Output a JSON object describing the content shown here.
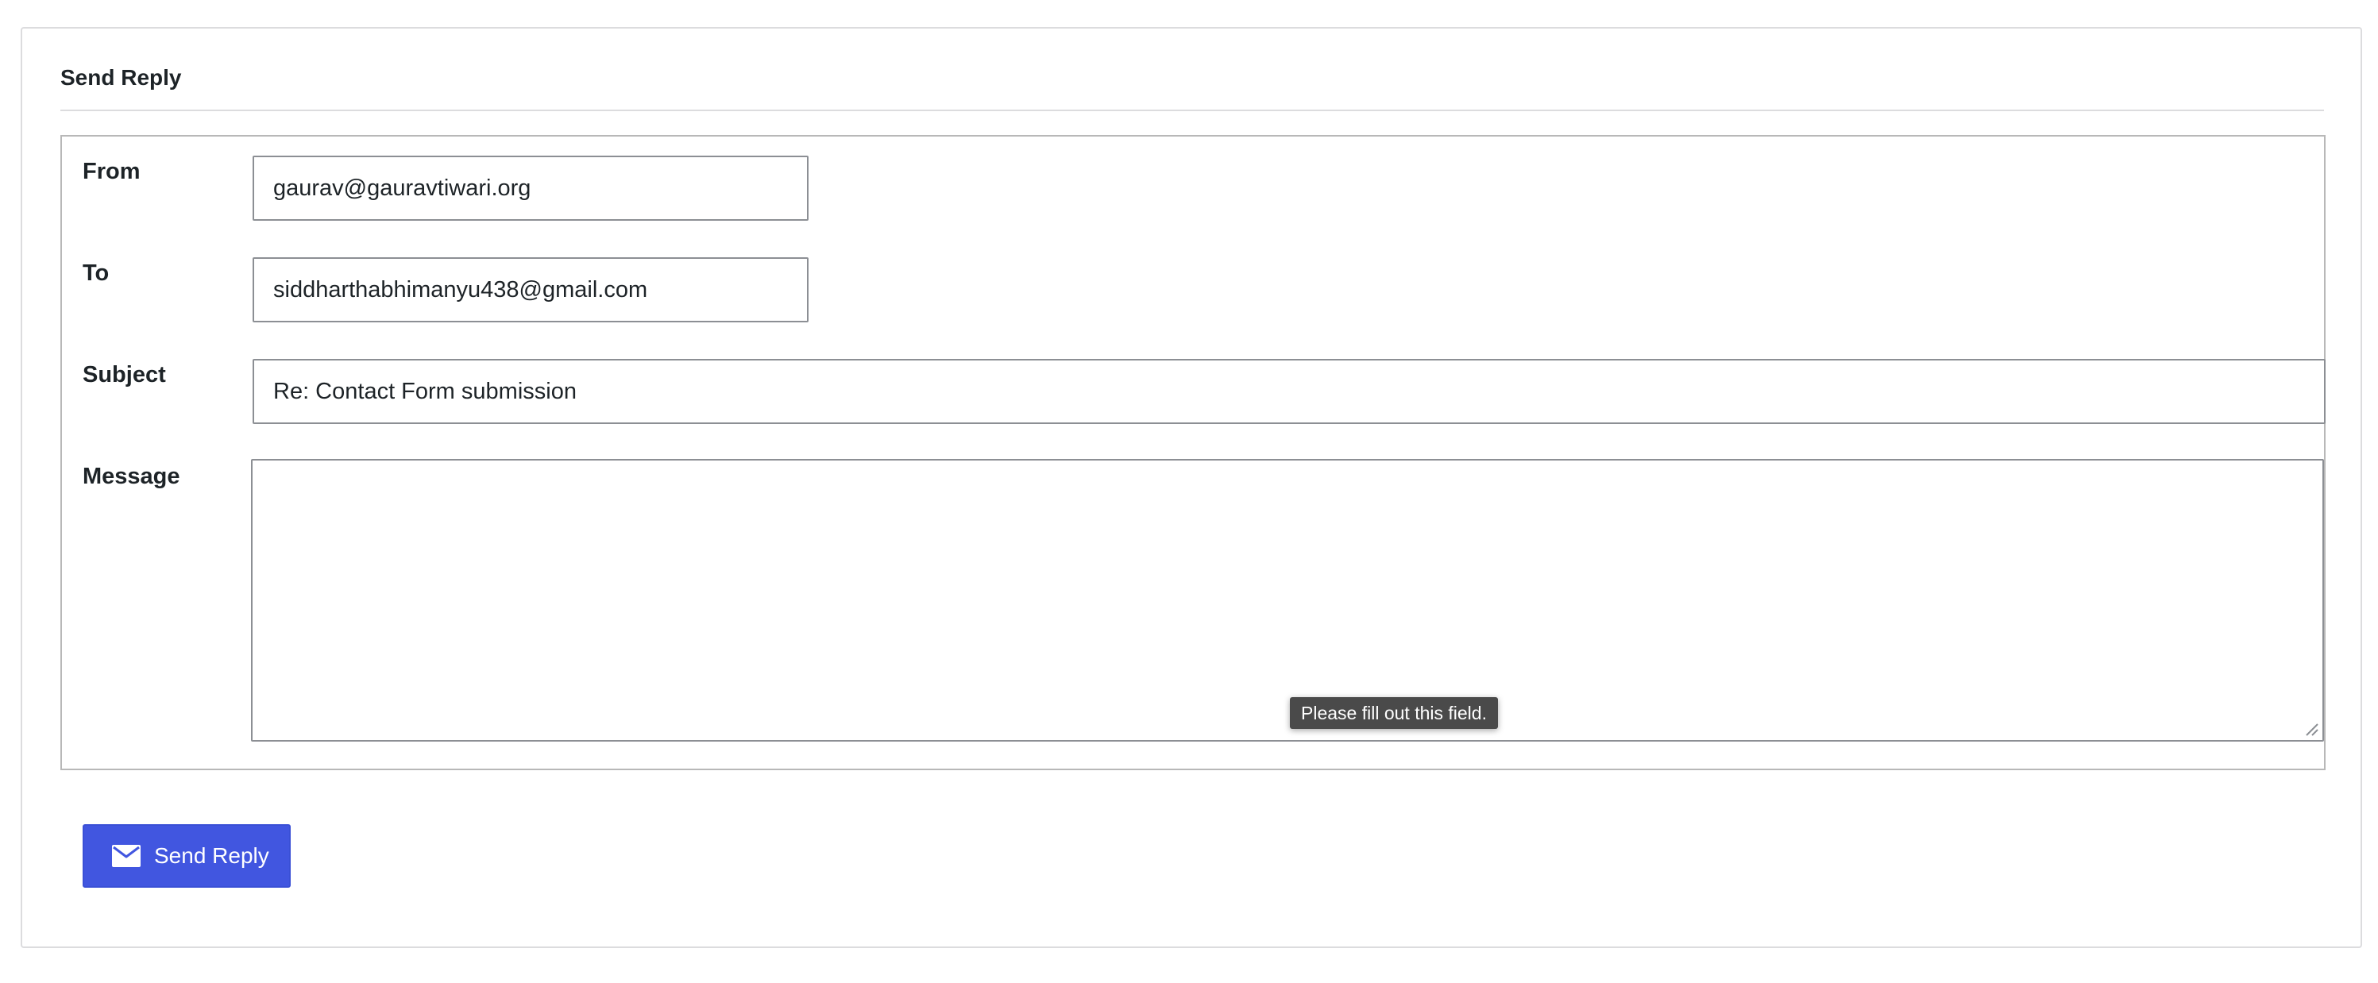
{
  "panel": {
    "title": "Send Reply"
  },
  "form": {
    "from": {
      "label": "From",
      "value": "gaurav@gauravtiwari.org"
    },
    "to": {
      "label": "To",
      "value": "siddharthabhimanyu438@gmail.com"
    },
    "subject": {
      "label": "Subject",
      "value": "Re: Contact Form submission"
    },
    "message": {
      "label": "Message",
      "value": ""
    }
  },
  "validation": {
    "tooltip": "Please fill out this field."
  },
  "actions": {
    "send_label": "Send Reply",
    "send_icon": "envelope-icon"
  },
  "colors": {
    "button_bg": "#4156e0",
    "tooltip_bg": "#4a4a4a",
    "border": "#8c8f94"
  }
}
